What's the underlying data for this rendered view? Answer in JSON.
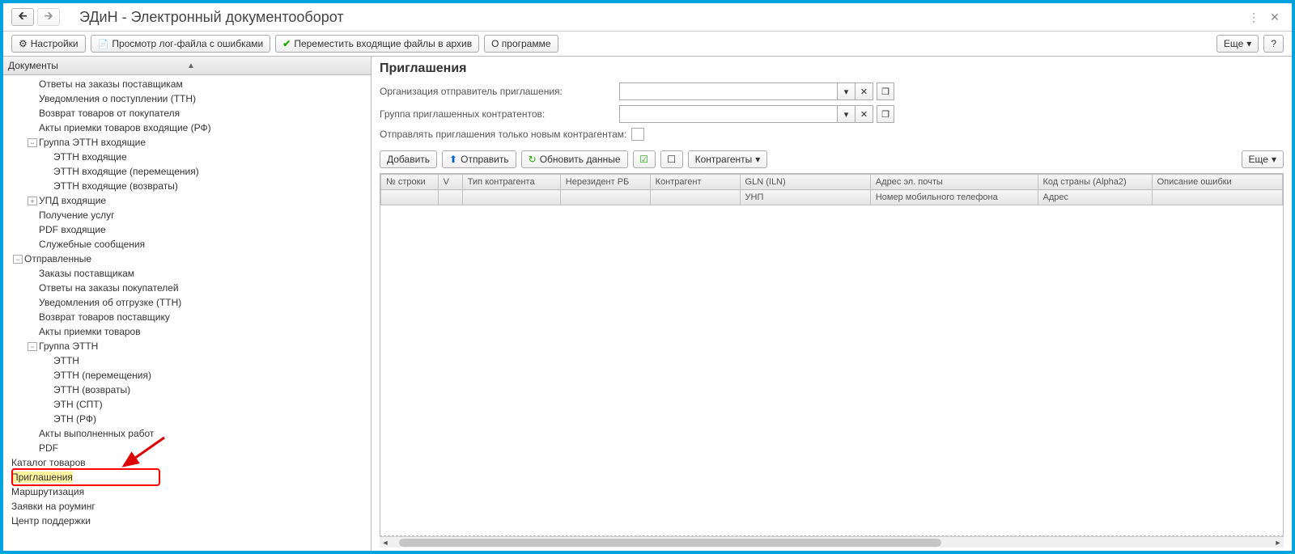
{
  "titlebar": {
    "title": "ЭДиН - Электронный документооборот"
  },
  "toolbar": {
    "settings": "Настройки",
    "view_log": "Просмотр лог-файла с ошибками",
    "archive": "Переместить входящие файлы в архив",
    "about": "О программе",
    "more": "Еще",
    "help": "?"
  },
  "sidebar": {
    "header": "Документы",
    "items": [
      {
        "label": "Ответы на заказы поставщикам",
        "indent": "pad1"
      },
      {
        "label": "Уведомления о поступлении (ТТН)",
        "indent": "pad1"
      },
      {
        "label": "Возврат товаров от покупателя",
        "indent": "pad1"
      },
      {
        "label": "Акты приемки товаров входящие (РФ)",
        "indent": "pad1"
      },
      {
        "label": "Группа ЭТТН входящие",
        "indent": "pad1",
        "exp": "-"
      },
      {
        "label": "ЭТТН входящие",
        "indent": "pad2"
      },
      {
        "label": "ЭТТН входящие (перемещения)",
        "indent": "pad2"
      },
      {
        "label": "ЭТТН входящие (возвраты)",
        "indent": "pad2"
      },
      {
        "label": "УПД входящие",
        "indent": "pad1",
        "exp": "+"
      },
      {
        "label": "Получение услуг",
        "indent": "pad1"
      },
      {
        "label": "PDF входящие",
        "indent": "pad1"
      },
      {
        "label": "Служебные сообщения",
        "indent": "pad1"
      },
      {
        "label": "Отправленные",
        "indent": "pad0",
        "exp": "-"
      },
      {
        "label": "Заказы поставщикам",
        "indent": "pad1"
      },
      {
        "label": "Ответы на заказы покупателей",
        "indent": "pad1"
      },
      {
        "label": "Уведомления об отгрузке (ТТН)",
        "indent": "pad1"
      },
      {
        "label": "Возврат товаров поставщику",
        "indent": "pad1"
      },
      {
        "label": "Акты приемки товаров",
        "indent": "pad1"
      },
      {
        "label": "Группа ЭТТН",
        "indent": "pad1",
        "exp": "-"
      },
      {
        "label": "ЭТТН",
        "indent": "pad2"
      },
      {
        "label": "ЭТТН (перемещения)",
        "indent": "pad2"
      },
      {
        "label": "ЭТТН (возвраты)",
        "indent": "pad2"
      },
      {
        "label": "ЭТН (СПТ)",
        "indent": "pad2"
      },
      {
        "label": "ЭТН (РФ)",
        "indent": "pad2"
      },
      {
        "label": "Акты выполненных работ",
        "indent": "pad1"
      },
      {
        "label": "PDF",
        "indent": "pad1"
      },
      {
        "label": "Каталог товаров",
        "indent": "padT"
      },
      {
        "label": "Приглашения",
        "indent": "padT",
        "selected": true
      },
      {
        "label": "Маршрутизация",
        "indent": "padT"
      },
      {
        "label": "Заявки на роуминг",
        "indent": "padT"
      },
      {
        "label": "Центр поддержки",
        "indent": "padT"
      }
    ]
  },
  "main": {
    "heading": "Приглашения",
    "form": {
      "sender_label": "Организация отправитель приглашения:",
      "group_label": "Группа приглашенных контратентов:",
      "only_new_label": "Отправлять приглашения только новым контрагентам:"
    },
    "actions": {
      "add": "Добавить",
      "send": "Отправить",
      "refresh": "Обновить данные",
      "counterparties": "Контрагенты",
      "more": "Еще"
    },
    "table": {
      "headers_row1": [
        "№ строки",
        "V",
        "Тип контрагента",
        "Нерезидент РБ",
        "Контрагент",
        "GLN (ILN)",
        "Адрес эл. почты",
        "Код страны (Alpha2)",
        "Описание ошибки"
      ],
      "headers_row2": [
        "",
        "",
        "",
        "",
        "",
        "УНП",
        "Номер мобильного телефона",
        "Адрес",
        ""
      ]
    }
  }
}
